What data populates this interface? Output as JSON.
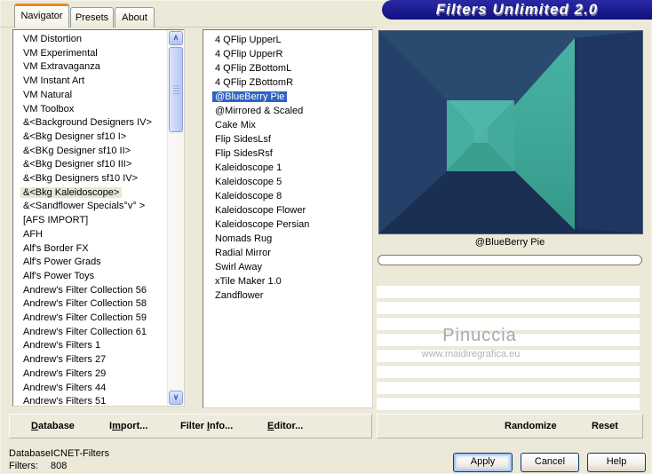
{
  "window": {
    "title": "Filters Unlimited 2.0"
  },
  "tabs": [
    {
      "label": "Navigator",
      "active": true
    },
    {
      "label": "Presets",
      "active": false
    },
    {
      "label": "About",
      "active": false
    }
  ],
  "left_list": {
    "selected": "&<Bkg Kaleidoscope>",
    "items": [
      "VM Distortion",
      "VM Experimental",
      "VM Extravaganza",
      "VM Instant Art",
      "VM Natural",
      "VM Toolbox",
      "&<Background Designers IV>",
      "&<Bkg Designer sf10 I>",
      "&<BKg Designer sf10 II>",
      "&<Bkg Designer sf10 III>",
      "&<Bkg Designers sf10 IV>",
      "&<Bkg Kaleidoscope>",
      "&<Sandflower Specials°v° >",
      "[AFS IMPORT]",
      "AFH",
      "Alf's Border FX",
      "Alf's Power Grads",
      "Alf's Power Toys",
      "Andrew's Filter Collection 56",
      "Andrew's Filter Collection 58",
      "Andrew's Filter Collection 59",
      "Andrew's Filter Collection 61",
      "Andrew's Filters 1",
      "Andrew's Filters 27",
      "Andrew's Filters 29",
      "Andrew's Filters 44",
      "Andrew's Filters 51"
    ]
  },
  "middle_list": {
    "selected": "@BlueBerry Pie",
    "items": [
      "4 QFlip UpperL",
      "4 QFlip UpperR",
      "4 QFlip ZBottomL",
      "4 QFlip ZBottomR",
      "@BlueBerry Pie",
      "@Mirrored & Scaled",
      "Cake Mix",
      "Flip SidesLsf",
      "Flip SidesRsf",
      "Kaleidoscope 1",
      "Kaleidoscope 5",
      "Kaleidoscope 8",
      "Kaleidoscope Flower",
      "Kaleidoscope Persian",
      "Nomads Rug",
      "Radial Mirror",
      "Swirl Away",
      "xTile Maker 1.0",
      "Zandflower"
    ]
  },
  "preview": {
    "caption": "@BlueBerry Pie",
    "watermark_line1": "Pinuccia",
    "watermark_line2": "www.maidiregrafica.eu",
    "empty_rows": 8,
    "colors": {
      "background_navy": "#20375a",
      "teal": "#41a99a"
    }
  },
  "scrollbar": {
    "up_icon": "∧",
    "down_icon": "∨"
  },
  "toolbar_left": [
    {
      "label": "Database",
      "key": "D"
    },
    {
      "label": "Import...",
      "key": "m"
    },
    {
      "label": "Filter Info...",
      "key": "I"
    },
    {
      "label": "Editor...",
      "key": "E"
    }
  ],
  "toolbar_right": [
    {
      "label": "Randomize",
      "key": ""
    },
    {
      "label": "Reset",
      "key": ""
    }
  ],
  "status": {
    "database_label": "Database:",
    "database_value": "ICNET-Filters",
    "filters_label": "Filters:",
    "filters_value": "808"
  },
  "action_buttons": [
    {
      "label": "Apply",
      "focused": true
    },
    {
      "label": "Cancel",
      "focused": false
    },
    {
      "label": "Help",
      "focused": false
    }
  ],
  "colors": {
    "dialog_bg": "#ece9d8",
    "banner_navy": "#14148c",
    "selection_blue": "#2f62c4",
    "inactive_selection": "#e9e6d8",
    "tab_accent_orange": "#e68b2c"
  }
}
